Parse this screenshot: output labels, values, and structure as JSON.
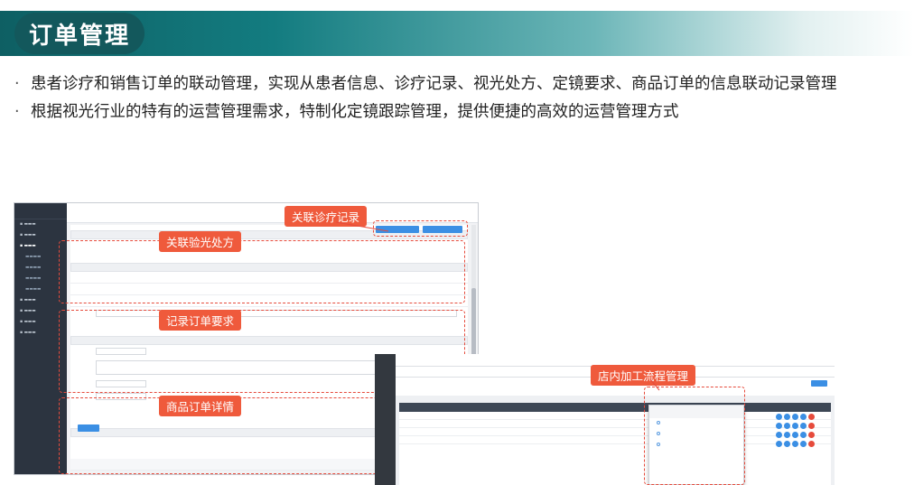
{
  "slide": {
    "title": "订单管理",
    "bullets": [
      "患者诊疗和销售订单的联动管理，实现从患者信息、诊疗记录、视光处方、定镜要求、商品订单的信息联动记录管理",
      "根据视光行业的特有的运营管理需求，特制化定镜跟踪管理，提供便捷的高效的运营管理方式"
    ],
    "bullet_marker": "·"
  },
  "callouts": {
    "link_record": "关联诊疗记录",
    "link_prescription": "关联验光处方",
    "record_requirements": "记录订单要求",
    "order_details": "商品订单详情",
    "inhouse_process": "店内加工流程管理"
  },
  "colors": {
    "title_dark": "#13585c",
    "callout_red": "#ef5a3c",
    "sidebar_dark": "#2c3440",
    "button_blue": "#3b8fe4",
    "table_header": "#3d4755"
  }
}
